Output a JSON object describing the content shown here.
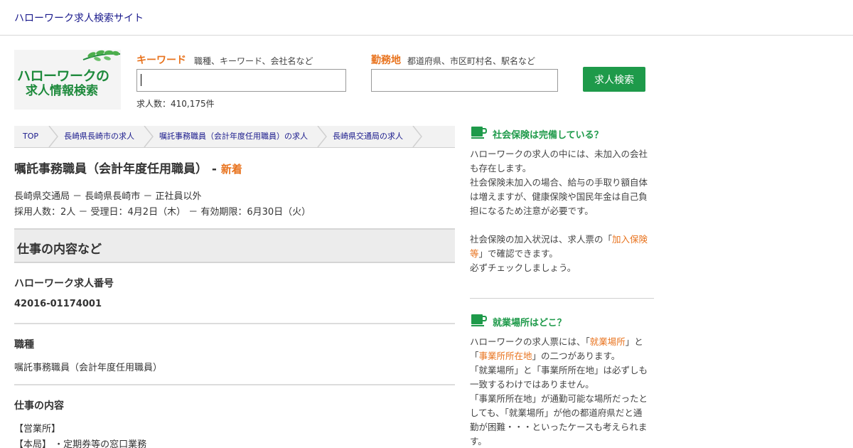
{
  "header": {
    "site_name": "ハローワーク求人検索サイト"
  },
  "logo": {
    "line1": "ハローワークの",
    "line2": "求人情報検索"
  },
  "search": {
    "keyword_label": "キーワード",
    "keyword_hint": "職種、キーワード、会社名など",
    "keyword_value": "",
    "location_label": "勤務地",
    "location_hint": "都道府県、市区町村名、駅名など",
    "location_value": "",
    "count_text": "求人数：410,175件",
    "button_label": "求人検索"
  },
  "breadcrumb": [
    "TOP",
    "長崎県長崎市の求人",
    "嘱託事務職員（会計年度任用職員）の求人",
    "長崎県交通局の求人"
  ],
  "job": {
    "title": "嘱託事務職員（会計年度任用職員）",
    "title_sep": " - ",
    "new_badge": "新着",
    "meta_line1": "長崎県交通局 － 長崎県長崎市 － 正社員以外",
    "meta_line2": "採用人数：2人 － 受理日：4月2日（木） － 有効期限：6月30日（火）"
  },
  "section": {
    "heading": "仕事の内容など",
    "number_label": "ハローワーク求人番号",
    "number_value": "42016-01174001",
    "occupation_label": "職種",
    "occupation_value": "嘱託事務職員（会計年度任用職員）",
    "content_label": "仕事の内容",
    "content_line1": "【営業所】",
    "content_line2": "【本局】 ・定期券等の窓口業務"
  },
  "sidebar": {
    "insurance": {
      "title": "社会保険は完備している？",
      "p1": "ハローワークの求人の中には、未加入の会社も存在します。",
      "p2": "社会保険未加入の場合、給与の手取り額自体は増えますが、健康保険や国民年金は自己負担になるため注意が必要です。",
      "p3_pre": "社会保険の加入状況は、求人票の「",
      "p3_hl": "加入保険等",
      "p3_post": "」で確認できます。",
      "p4": "必ずチェックしましょう。"
    },
    "workplace": {
      "title": "就業場所はどこ？",
      "p1_pre": "ハローワークの求人票には、「",
      "p1_hl1": "就業場所",
      "p1_mid": "」と「",
      "p1_hl2": "事業所所在地",
      "p1_post": "」の二つがあります。",
      "p2": "「就業場所」と「事業所所在地」は必ずしも一致するわけではありません。",
      "p3": "「事業所所在地」が通勤可能な場所だったとしても、「就業場所」が他の都道府県だと通勤が困難・・・といったケースも考えられます。"
    }
  },
  "colors": {
    "accent_orange": "#e8731e",
    "brand_green": "#1e9a4a",
    "link_navy": "#1a1a8c"
  }
}
